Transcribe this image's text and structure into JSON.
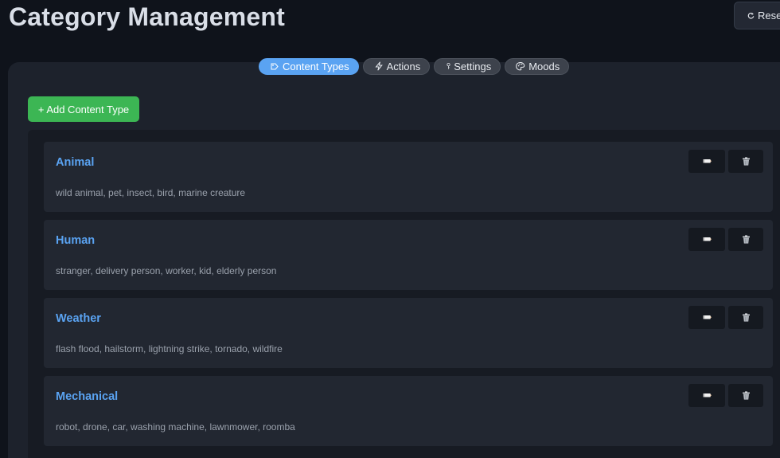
{
  "header": {
    "title": "Category Management",
    "reset_label": "Rese"
  },
  "tabs": [
    {
      "label": "Content Types",
      "icon": "tag-icon",
      "active": true
    },
    {
      "label": "Actions",
      "icon": "lightning-icon",
      "active": false
    },
    {
      "label": "Settings",
      "icon": "key-icon",
      "active": false
    },
    {
      "label": "Moods",
      "icon": "palette-icon",
      "active": false
    }
  ],
  "add_button_label": "+ Add Content Type",
  "categories": [
    {
      "name": "Animal",
      "description": "wild animal, pet, insect, bird, marine creature"
    },
    {
      "name": "Human",
      "description": "stranger, delivery person, worker, kid, elderly person"
    },
    {
      "name": "Weather",
      "description": "flash flood, hailstorm, lightning strike, tornado, wildfire"
    },
    {
      "name": "Mechanical",
      "description": "robot, drone, car, washing machine, lawnmower, roomba"
    }
  ],
  "colors": {
    "accent": "#5aa3f2",
    "add_button": "#3cb654",
    "background": "#0f131b",
    "panel": "#1d222c",
    "card": "#222731"
  }
}
